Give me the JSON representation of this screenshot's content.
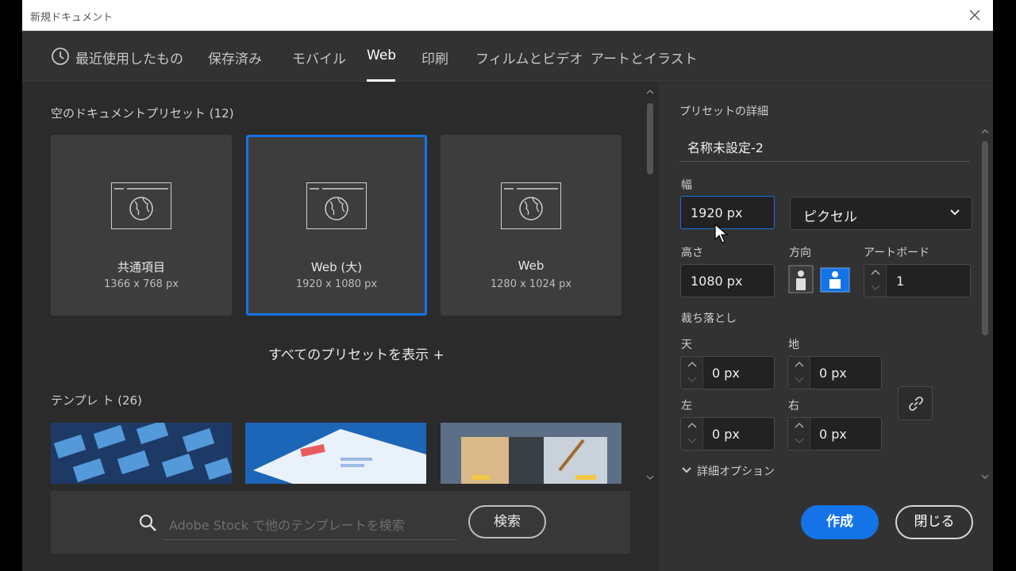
{
  "window": {
    "title": "新規ドキュメント"
  },
  "tabs": [
    {
      "label": "最近使用したもの",
      "icon": "clock-icon"
    },
    {
      "label": "保存済み"
    },
    {
      "label": "モバイル"
    },
    {
      "label": "Web",
      "active": true
    },
    {
      "label": "印刷"
    },
    {
      "label": "フィルムとビデオ"
    },
    {
      "label": "アートとイラスト"
    }
  ],
  "presets": {
    "title": "空のドキュメントプリセット (12)",
    "items": [
      {
        "name": "共通項目",
        "dims": "1366 x 768 px"
      },
      {
        "name": "Web (大)",
        "dims": "1920 x 1080 px",
        "selected": true
      },
      {
        "name": "Web",
        "dims": "1280 x 1024 px"
      }
    ],
    "show_all": "すべてのプリセットを表示 +"
  },
  "templates": {
    "title": "テンプレ ト (26)"
  },
  "search": {
    "placeholder": "Adobe Stock で他のテンプレートを検索",
    "button": "検索"
  },
  "details": {
    "title": "プリセットの詳細",
    "name": "名称未設定-2",
    "width_label": "幅",
    "width": "1920 px",
    "unit": "ピクセル",
    "height_label": "高さ",
    "height": "1080 px",
    "orientation_label": "方向",
    "artboard_label": "アートボード",
    "artboard": "1",
    "bleed_label": "裁ち落とし",
    "top_label": "天",
    "top": "0 px",
    "bottom_label": "地",
    "bottom": "0 px",
    "left_label": "左",
    "left": "0 px",
    "right_label": "右",
    "right": "0 px",
    "advanced": "詳細オプション"
  },
  "actions": {
    "create": "作成",
    "close": "閉じる"
  },
  "colors": {
    "accent": "#1473e6"
  }
}
